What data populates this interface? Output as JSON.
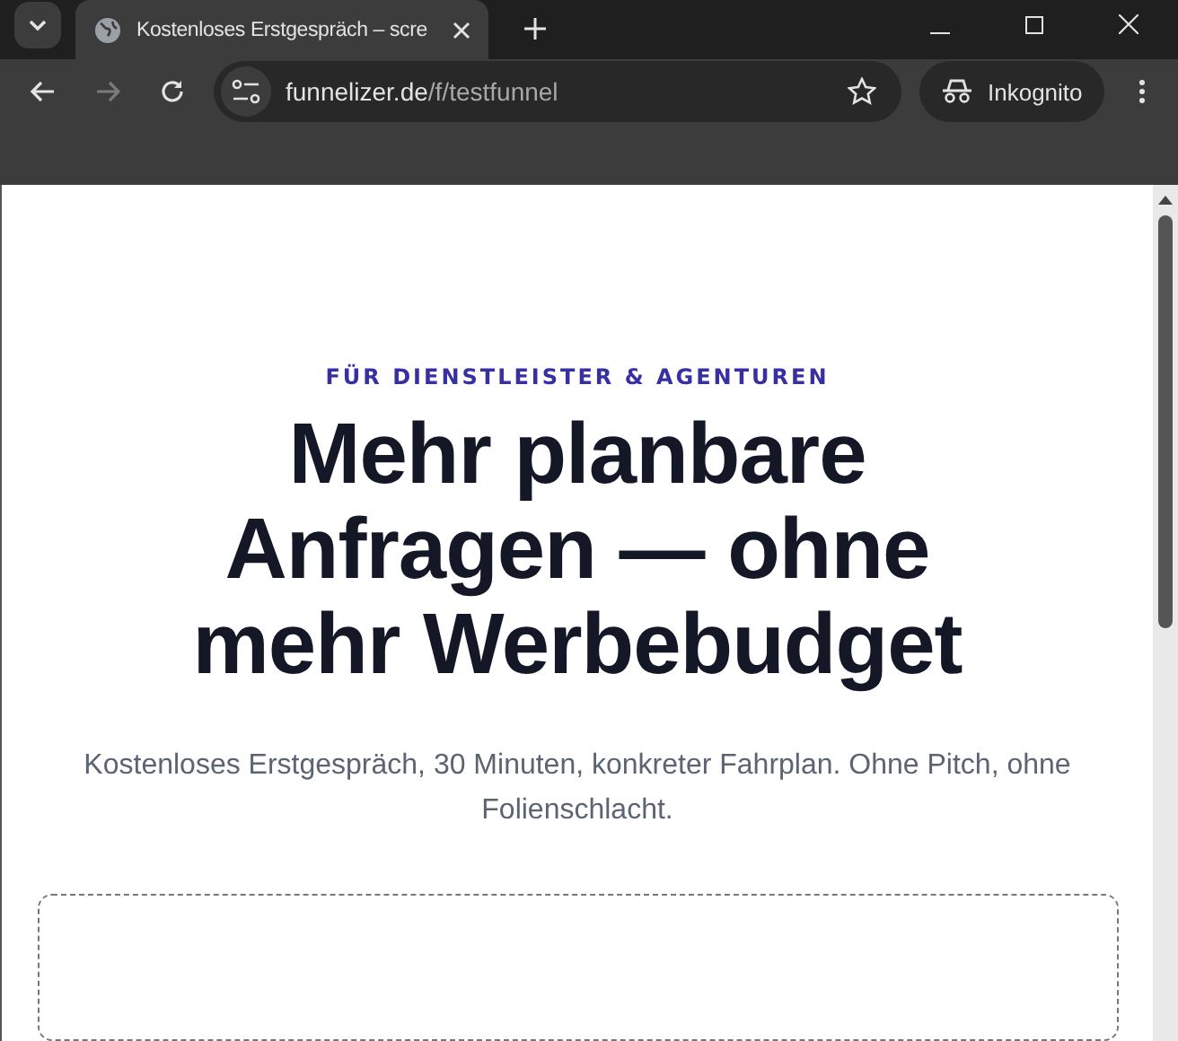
{
  "browser": {
    "tabs": [
      {
        "title": "Kostenloses Erstgespräch – scre",
        "selected": true
      }
    ],
    "address": {
      "host": "funnelizer.de",
      "path": "/f/testfunnel"
    },
    "profile_label": "Inkognito"
  },
  "page": {
    "eyebrow": "FÜR DIENSTLEISTER & AGENTUREN",
    "headline": "Mehr planbare Anfragen — ohne mehr Werbebudget",
    "subtitle": "Kostenloses Erstgespräch, 30 Minuten, konkreter Fahrplan. Ohne Pitch, ohne Folienschlacht."
  }
}
